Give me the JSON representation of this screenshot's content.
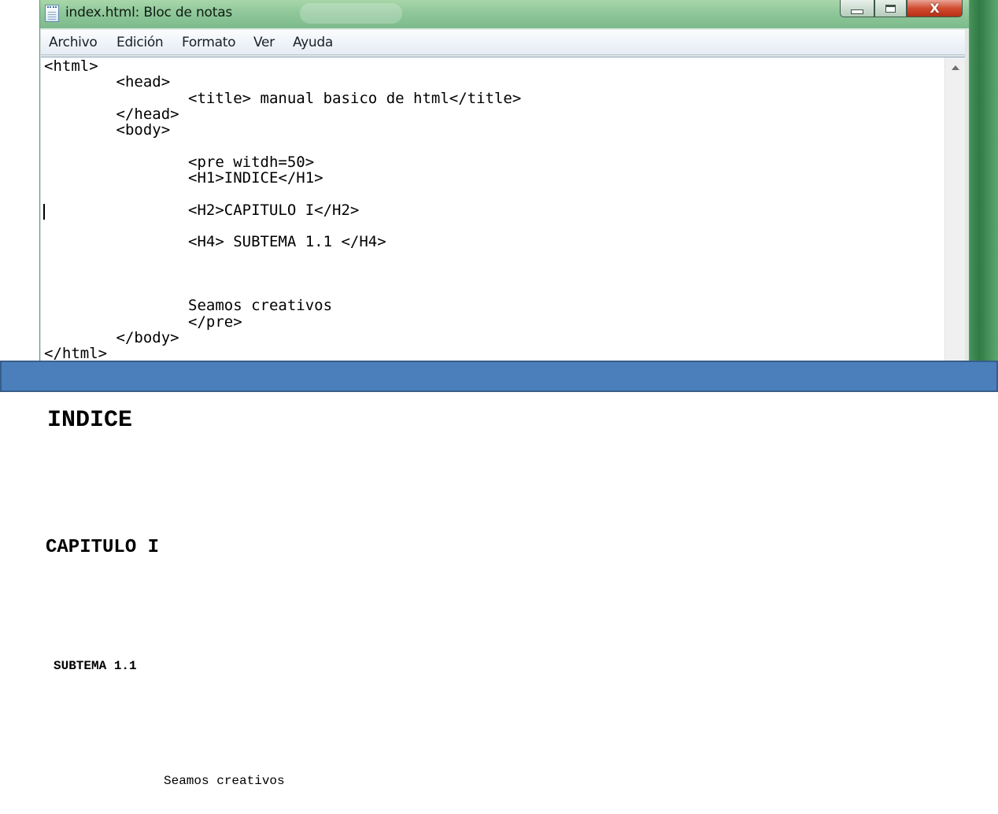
{
  "window": {
    "title": "index.html: Bloc de notas",
    "close_glyph": "X",
    "icon": "notepad-icon"
  },
  "menu": {
    "items": [
      {
        "label": "Archivo"
      },
      {
        "label": "Edición"
      },
      {
        "label": "Formato"
      },
      {
        "label": "Ver"
      },
      {
        "label": "Ayuda"
      }
    ]
  },
  "editor": {
    "content": "<html>\n\t<head>\n\t\t<title> manual basico de html</title>\n\t</head>\n\t<body>\n\n\t\t<pre witdh=50>\n\t\t<H1>INDICE</H1>\n\n\t\t<H2>CAPITULO I</H2>\n\n\t\t<H4> SUBTEMA 1.1 </H4>\n\n\n\n\t\tSeamos creativos\n\t\t</pre>\n\t</body>\n</html>"
  },
  "output": {
    "h1": "INDICE",
    "h2": "CAPITULO I",
    "h4": "SUBTEMA 1.1",
    "text": "Seamos creativos"
  },
  "colors": {
    "banner": "#4a7fbb",
    "titlebar": "#8fc79a",
    "close_button": "#d24b31"
  }
}
